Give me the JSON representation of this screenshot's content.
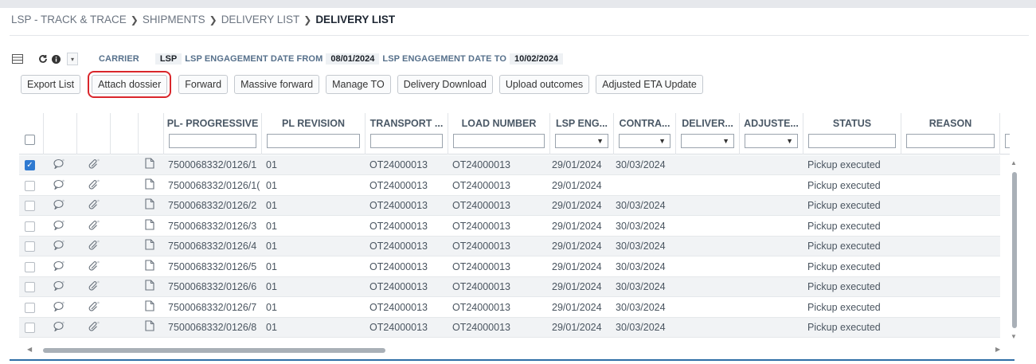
{
  "breadcrumb": {
    "items": [
      "LSP - TRACK & TRACE",
      "SHIPMENTS",
      "DELIVERY LIST"
    ],
    "current": "DELIVERY LIST"
  },
  "filters": {
    "carrier_label": "CARRIER",
    "carrier_value": "LSP",
    "date_from_label": "LSP ENGAGEMENT DATE FROM",
    "date_from_value": "08/01/2024",
    "date_to_label": "LSP ENGAGEMENT DATE TO",
    "date_to_value": "10/02/2024"
  },
  "toolbar": {
    "export_list": "Export List",
    "attach_dossier": "Attach dossier",
    "forward": "Forward",
    "massive_forward": "Massive forward",
    "manage_to": "Manage TO",
    "delivery_download": "Delivery Download",
    "upload_outcomes": "Upload outcomes",
    "adjusted_eta_update": "Adjusted ETA Update"
  },
  "grid": {
    "columns": [
      "PL- PROGRESSIVE",
      "PL REVISION",
      "TRANSPORT ...",
      "LOAD NUMBER",
      "LSP ENG...",
      "CONTRA...",
      "DELIVER...",
      "ADJUSTE...",
      "STATUS",
      "REASON"
    ],
    "rows": [
      {
        "progressive": "7500068332/0126/1",
        "revision": "01",
        "transport": "OT24000013",
        "load": "OT24000013",
        "lsp_eng": "29/01/2024",
        "contract": "30/03/2024",
        "status": "Pickup executed",
        "checked": true
      },
      {
        "progressive": "7500068332/0126/1(",
        "revision": "01",
        "transport": "OT24000013",
        "load": "OT24000013",
        "lsp_eng": "29/01/2024",
        "contract": "",
        "status": "Pickup executed",
        "checked": false
      },
      {
        "progressive": "7500068332/0126/2",
        "revision": "01",
        "transport": "OT24000013",
        "load": "OT24000013",
        "lsp_eng": "29/01/2024",
        "contract": "30/03/2024",
        "status": "Pickup executed",
        "checked": false
      },
      {
        "progressive": "7500068332/0126/3",
        "revision": "01",
        "transport": "OT24000013",
        "load": "OT24000013",
        "lsp_eng": "29/01/2024",
        "contract": "30/03/2024",
        "status": "Pickup executed",
        "checked": false
      },
      {
        "progressive": "7500068332/0126/4",
        "revision": "01",
        "transport": "OT24000013",
        "load": "OT24000013",
        "lsp_eng": "29/01/2024",
        "contract": "30/03/2024",
        "status": "Pickup executed",
        "checked": false
      },
      {
        "progressive": "7500068332/0126/5",
        "revision": "01",
        "transport": "OT24000013",
        "load": "OT24000013",
        "lsp_eng": "29/01/2024",
        "contract": "30/03/2024",
        "status": "Pickup executed",
        "checked": false
      },
      {
        "progressive": "7500068332/0126/6",
        "revision": "01",
        "transport": "OT24000013",
        "load": "OT24000013",
        "lsp_eng": "29/01/2024",
        "contract": "30/03/2024",
        "status": "Pickup executed",
        "checked": false
      },
      {
        "progressive": "7500068332/0126/7",
        "revision": "01",
        "transport": "OT24000013",
        "load": "OT24000013",
        "lsp_eng": "29/01/2024",
        "contract": "30/03/2024",
        "status": "Pickup executed",
        "checked": false
      },
      {
        "progressive": "7500068332/0126/8",
        "revision": "01",
        "transport": "OT24000013",
        "load": "OT24000013",
        "lsp_eng": "29/01/2024",
        "contract": "30/03/2024",
        "status": "Pickup executed",
        "checked": false
      }
    ]
  },
  "icons": {
    "grid_view": "grid-view-icon",
    "refresh": "refresh-icon",
    "info": "info-icon",
    "comment": "comment-icon",
    "attachment": "paperclip-icon",
    "document": "document-icon"
  },
  "colors": {
    "accent": "#2f7ad1",
    "highlight_outline": "#d9262b",
    "bottom_bar": "#2e6ea6"
  }
}
